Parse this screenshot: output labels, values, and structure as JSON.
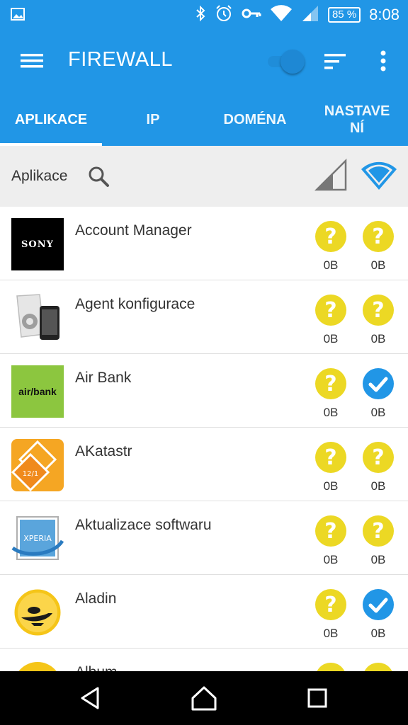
{
  "status_bar": {
    "time": "8:08",
    "battery": "85 %",
    "icons": [
      "image-icon",
      "bluetooth-icon",
      "alarm-icon",
      "vpn-key-icon",
      "wifi-icon",
      "signal-icon"
    ]
  },
  "app_bar": {
    "title": "FIREWALL",
    "accent": "#2196e6",
    "icons": [
      "menu-icon",
      "sort-icon",
      "more-vert-icon"
    ]
  },
  "tabs": [
    {
      "label": "APLIKACE",
      "active": true
    },
    {
      "label": "IP",
      "active": false
    },
    {
      "label": "DOMÉNA",
      "active": false
    },
    {
      "label": "NASTAVE\nNÍ",
      "active": false
    }
  ],
  "filter": {
    "label": "Aplikace",
    "icons": [
      "search-icon",
      "cellular-signal-icon",
      "wifi-icon"
    ]
  },
  "apps": [
    {
      "name": "Account Manager",
      "icon": "sony-logo",
      "icon_text": "SONY",
      "mobile_status": "unknown",
      "wifi_status": "unknown",
      "mobile_bytes": "0B",
      "wifi_bytes": "0B"
    },
    {
      "name": "Agent konfigurace",
      "icon": "config-agent-logo",
      "icon_text": "",
      "mobile_status": "unknown",
      "wifi_status": "unknown",
      "mobile_bytes": "0B",
      "wifi_bytes": "0B"
    },
    {
      "name": "Air Bank",
      "icon": "airbank-logo",
      "icon_text": "air/bank",
      "mobile_status": "unknown",
      "wifi_status": "allowed",
      "mobile_bytes": "0B",
      "wifi_bytes": "0B"
    },
    {
      "name": "AKatastr",
      "icon": "akatastr-logo",
      "icon_text": "12/1",
      "mobile_status": "unknown",
      "wifi_status": "unknown",
      "mobile_bytes": "0B",
      "wifi_bytes": "0B"
    },
    {
      "name": "Aktualizace softwaru",
      "icon": "xperia-logo",
      "icon_text": "XPERIA",
      "mobile_status": "unknown",
      "wifi_status": "unknown",
      "mobile_bytes": "0B",
      "wifi_bytes": "0B"
    },
    {
      "name": "Aladin",
      "icon": "aladin-logo",
      "icon_text": "",
      "mobile_status": "unknown",
      "wifi_status": "allowed",
      "mobile_bytes": "0B",
      "wifi_bytes": "0B"
    },
    {
      "name": "Album",
      "icon": "album-logo",
      "icon_text": "",
      "mobile_status": "unknown",
      "wifi_status": "unknown",
      "mobile_bytes": "",
      "wifi_bytes": ""
    }
  ],
  "colors": {
    "unknown": "#ecd824",
    "allowed": "#2196e6"
  },
  "nav_bar": {
    "icons": [
      "back-icon",
      "home-icon",
      "recents-icon"
    ]
  }
}
